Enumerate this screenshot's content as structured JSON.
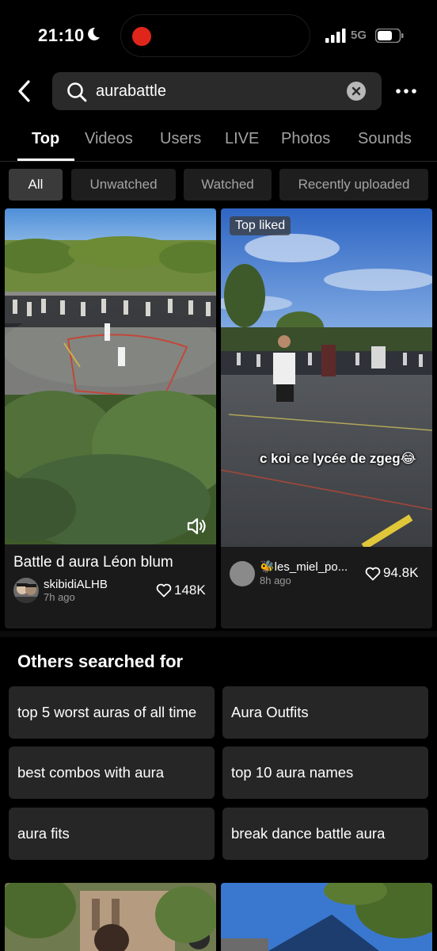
{
  "status_bar": {
    "time": "21:10",
    "network": "5G"
  },
  "search": {
    "query": "aurabattle"
  },
  "tabs": [
    "Top",
    "Videos",
    "Users",
    "LIVE",
    "Photos",
    "Sounds"
  ],
  "filters": [
    "All",
    "Unwatched",
    "Watched",
    "Recently uploaded"
  ],
  "cards": [
    {
      "title": "Battle d aura Léon blum",
      "author": "skibidiALHB",
      "age": "7h ago",
      "likes": "148K"
    },
    {
      "badge": "Top liked",
      "overlay_caption": "c koi ce lycée de zgeg😂",
      "author": "🐝les_miel_po...",
      "age": "8h ago",
      "likes": "94.8K"
    }
  ],
  "others": {
    "title": "Others searched for",
    "items": [
      "top 5 worst auras of all time",
      "Aura Outfits",
      "best combos with aura",
      "top 10 aura names",
      "aura fits",
      "break dance battle aura"
    ]
  }
}
